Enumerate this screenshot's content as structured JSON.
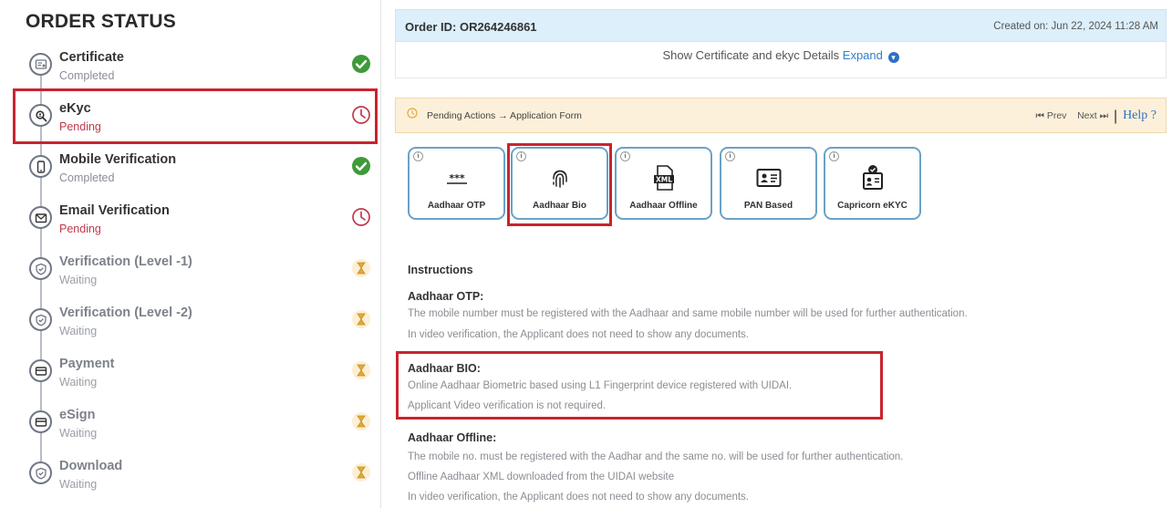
{
  "sidebar": {
    "title": "ORDER STATUS",
    "steps": [
      {
        "name": "Certificate",
        "state": "Completed",
        "icon": "certificate-icon",
        "status": "check-icon"
      },
      {
        "name": "eKyc",
        "state": "Pending",
        "icon": "search-icon",
        "status": "clock-icon"
      },
      {
        "name": "Mobile Verification",
        "state": "Completed",
        "icon": "mobile-icon",
        "status": "check-icon"
      },
      {
        "name": "Email Verification",
        "state": "Pending",
        "icon": "mail-icon",
        "status": "clock-icon"
      },
      {
        "name": "Verification (Level -1)",
        "state": "Waiting",
        "icon": "shield-icon",
        "status": "hourglass-icon"
      },
      {
        "name": "Verification (Level -2)",
        "state": "Waiting",
        "icon": "shield-icon",
        "status": "hourglass-icon"
      },
      {
        "name": "Payment",
        "state": "Waiting",
        "icon": "card-icon",
        "status": "hourglass-icon"
      },
      {
        "name": "eSign",
        "state": "Waiting",
        "icon": "card-icon",
        "status": "hourglass-icon"
      },
      {
        "name": "Download",
        "state": "Waiting",
        "icon": "shield-icon",
        "status": "hourglass-icon"
      }
    ]
  },
  "header": {
    "order_id": "Order ID: OR264246861",
    "created_on": "Created on: Jun 22, 2024 11:28 AM",
    "expand_text": "Show Certificate and ekyc Details",
    "expand_link": "Expand"
  },
  "pending": {
    "text": "Pending Actions → Application Form",
    "prev": "⏮ Prev",
    "next": "Next ⏭",
    "separator": "|",
    "help": "Help ?"
  },
  "methods": [
    {
      "label": "Aadhaar OTP",
      "icon": "otp-icon"
    },
    {
      "label": "Aadhaar Bio",
      "icon": "fingerprint-icon"
    },
    {
      "label": "Aadhaar Offline",
      "icon": "xml-file-icon"
    },
    {
      "label": "PAN Based",
      "icon": "id-card-icon"
    },
    {
      "label": "Capricorn eKYC",
      "icon": "user-verified-icon"
    }
  ],
  "instructions": {
    "title": "Instructions",
    "otp_head": "Aadhaar OTP:",
    "otp_line1": "The mobile number must be registered with the Aadhaar and same mobile number will be used for further authentication.",
    "otp_line2": "In video verification, the Applicant does not need to show any documents.",
    "bio_head": "Aadhaar BIO:",
    "bio_line1": "Online Aadhaar Biometric based using L1 Fingerprint device registered with UIDAI.",
    "bio_line2": "Applicant Video verification is not required.",
    "offline_head": "Aadhaar Offline:",
    "offline_line1": "The mobile no. must be registered with the Aadhar and the same no. will be used for further authentication.",
    "offline_line2": "Offline Aadhaar XML downloaded from the UIDAI website",
    "offline_line3": "In video verification, the Applicant does not need to show any documents."
  },
  "colors": {
    "completed": "#3f9a3a",
    "pending": "#c0394b",
    "waiting": "#e2a93b",
    "highlight": "#c8242f",
    "link": "#2f80d1"
  }
}
